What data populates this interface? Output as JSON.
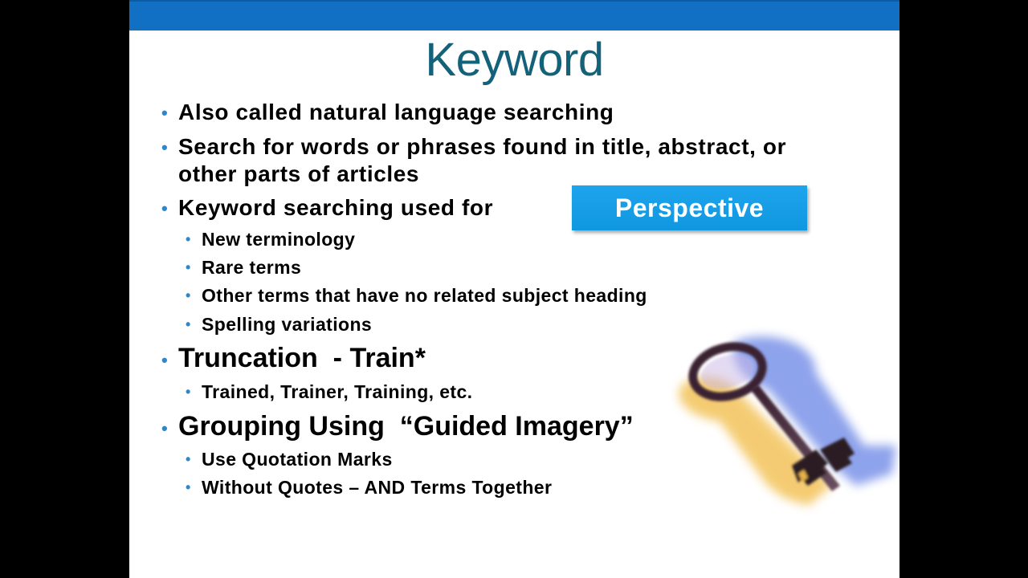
{
  "slide": {
    "title": "Keyword",
    "header_color": "#1170c4",
    "title_color": "#14627a",
    "bullet_color": "#2f86c8",
    "bullets": [
      {
        "level": 1,
        "text": "Also called natural language searching"
      },
      {
        "level": 1,
        "text": "Search for words or phrases found in title, abstract, or"
      },
      {
        "level": 1,
        "text": "other parts of articles",
        "continuation": true
      },
      {
        "level": 1,
        "text": "Keyword searching used for"
      },
      {
        "level": 2,
        "text": "New terminology"
      },
      {
        "level": 2,
        "text": "Rare terms"
      },
      {
        "level": 2,
        "text": "Other terms that have no related subject heading"
      },
      {
        "level": 2,
        "text": "Spelling variations"
      },
      {
        "level": 1,
        "text": "Truncation  - Train*",
        "large": true
      },
      {
        "level": 2,
        "text": "Trained, Trainer, Training, etc."
      },
      {
        "level": 1,
        "text": "Grouping Using  “Guided Imagery”",
        "large": true
      },
      {
        "level": 2,
        "text": "Use Quotation Marks"
      },
      {
        "level": 2,
        "text": "Without Quotes – AND Terms Together"
      }
    ],
    "perspective_button": {
      "label": "Perspective",
      "color": "#1ea4ec"
    },
    "image": {
      "icon": "key-icon",
      "description": "skeleton key illustration"
    }
  }
}
